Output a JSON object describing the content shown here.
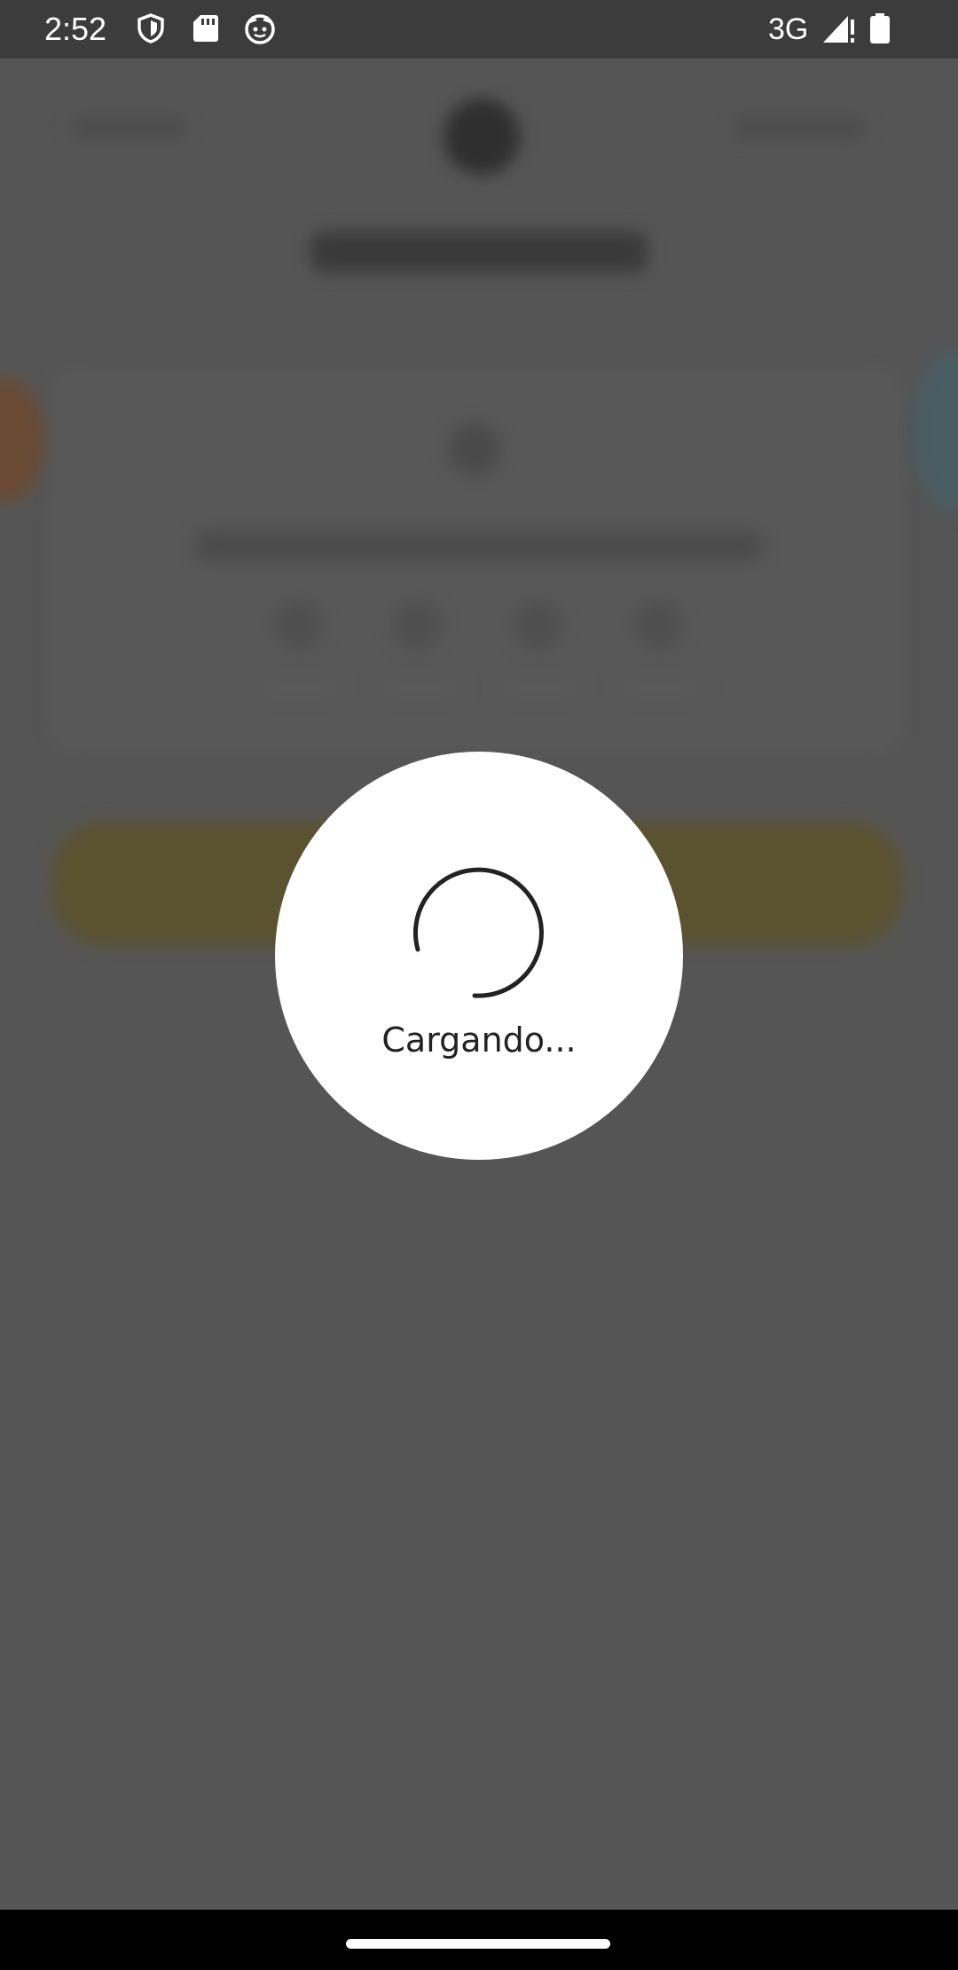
{
  "status_bar": {
    "time": "2:52",
    "network": "3G",
    "icons": [
      "shield-icon",
      "sd-card-icon",
      "cat-face-icon",
      "signal-icon",
      "battery-icon"
    ]
  },
  "loading": {
    "text": "Cargando..."
  },
  "colors": {
    "overlay": "#555555",
    "dialog": "#ffffff",
    "status_bar": "#3c3c3c",
    "nav_bar": "#000000"
  }
}
